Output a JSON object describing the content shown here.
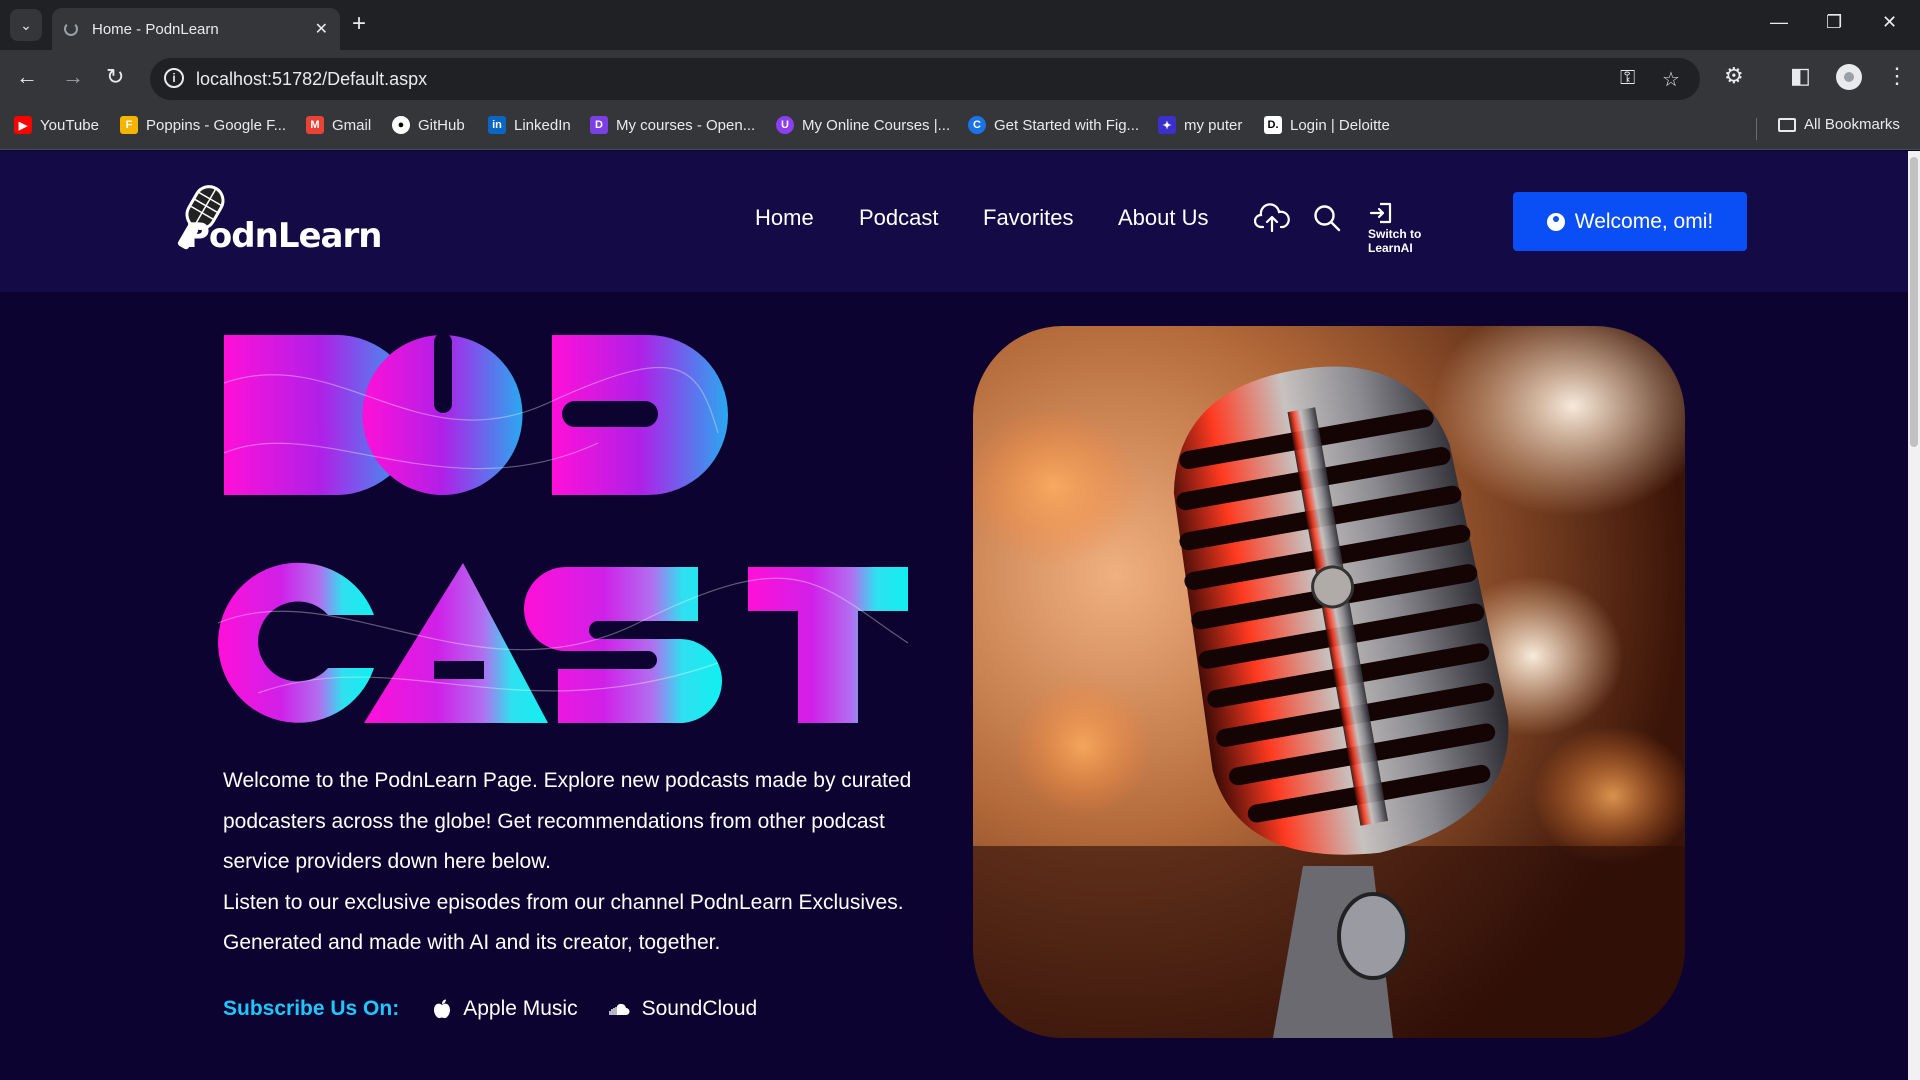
{
  "browser": {
    "tab_title": "Home - PodnLearn",
    "url": "localhost:51782/Default.aspx",
    "bookmarks": [
      {
        "label": "YouTube",
        "color": "#ff0000"
      },
      {
        "label": "Poppins - Google F...",
        "color": "#f4b400"
      },
      {
        "label": "Gmail",
        "color": "#ea4335"
      },
      {
        "label": "GitHub",
        "color": "#ffffff"
      },
      {
        "label": "LinkedIn",
        "color": "#0a66c2"
      },
      {
        "label": "My courses - Open...",
        "color": "#7b3fe4"
      },
      {
        "label": "My Online Courses |...",
        "color": "#8b3ff0"
      },
      {
        "label": "Get Started with Fig...",
        "color": "#1a73e8"
      },
      {
        "label": "my puter",
        "color": "#3b30c9"
      },
      {
        "label": "Login | Deloitte",
        "color": "#ffffff"
      }
    ],
    "all_bookmarks": "All Bookmarks"
  },
  "site": {
    "logo_text": "PodnLearn",
    "nav": [
      "Home",
      "Podcast",
      "Favorites",
      "About Us"
    ],
    "switch_label": "Switch to LearnAI",
    "welcome": "Welcome, omi!"
  },
  "hero": {
    "title_line1": "POD",
    "title_line2": "CAST",
    "description_1": "Welcome to the PodnLearn Page. Explore new podcasts made by curated podcasters across the globe! Get recommendations from other podcast service providers down here below.",
    "description_2": "Listen to our exclusive episodes from our channel PodnLearn Exclusives. Generated and made with AI and its creator, together.",
    "subscribe_label": "Subscribe Us On:",
    "providers": [
      "Apple Music",
      "SoundCloud"
    ]
  },
  "colors": {
    "page_bg": "#0d0330",
    "header_bg": "#140a45",
    "accent_button": "#0a4ff5",
    "subscribe_label": "#1ec8ff",
    "gradient_pink": "#ff10d8",
    "gradient_cyan": "#10f0f0"
  }
}
